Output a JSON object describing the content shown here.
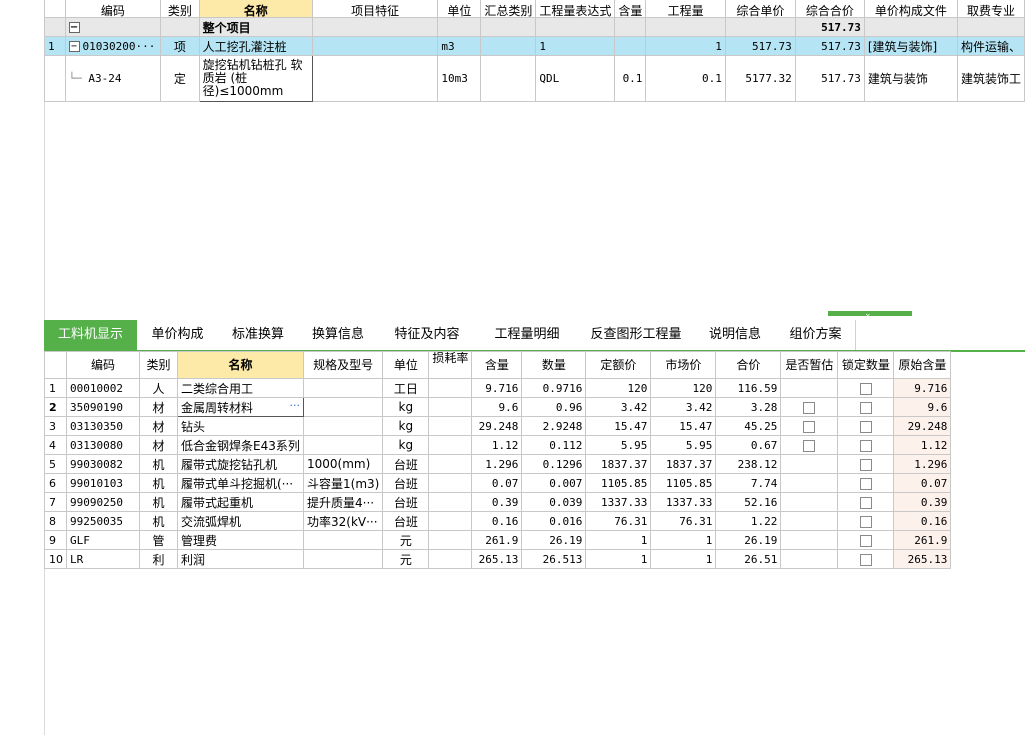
{
  "top_table": {
    "headers": [
      "编码",
      "类别",
      "名称",
      "项目特征",
      "单位",
      "汇总类别",
      "工程量表达式",
      "含量",
      "工程量",
      "综合单价",
      "综合合价",
      "单价构成文件",
      "取费专业"
    ],
    "summary": {
      "name": "整个项目",
      "total": "517.73"
    },
    "rows": [
      {
        "num": "1",
        "code": "01030200···",
        "type": "项",
        "name": "人工挖孔灌注桩",
        "feature": "",
        "unit": "m3",
        "sumcat": "",
        "expr": "1",
        "content": "",
        "qty": "1",
        "unit_price": "517.73",
        "total": "517.73",
        "price_file": "[建筑与装饰]",
        "fee": "构件运输、"
      },
      {
        "num": "",
        "code": "A3-24",
        "type": "定",
        "name": "旋挖钻机钻桩孔 软质岩 (桩径)≤1000mm",
        "feature": "",
        "unit": "10m3",
        "sumcat": "",
        "expr": "QDL",
        "content": "0.1",
        "qty": "0.1",
        "unit_price": "5177.32",
        "total": "517.73",
        "price_file": "建筑与装饰",
        "fee": "建筑装饰工"
      }
    ]
  },
  "tabs": [
    "工料机显示",
    "单价构成",
    "标准换算",
    "换算信息",
    "特征及内容",
    "工程量明细",
    "反查图形工程量",
    "说明信息",
    "组价方案"
  ],
  "bottom_table": {
    "headers": [
      "编码",
      "类别",
      "名称",
      "规格及型号",
      "单位",
      "损耗率",
      "含量",
      "数量",
      "定额价",
      "市场价",
      "合价",
      "是否暂估",
      "锁定数量",
      "原始含量"
    ],
    "rows": [
      {
        "num": "1",
        "code": "00010002",
        "type": "人",
        "name": "二类综合用工",
        "spec": "",
        "unit": "工日",
        "loss": "",
        "content": "9.716",
        "qty": "0.9716",
        "quota": "120",
        "market": "120",
        "total": "116.59",
        "est": false,
        "lock": true,
        "orig": "9.716"
      },
      {
        "num": "2",
        "code": "35090190",
        "type": "材",
        "name": "金属周转材料",
        "spec": "",
        "unit": "kg",
        "loss": "",
        "content": "9.6",
        "qty": "0.96",
        "quota": "3.42",
        "market": "3.42",
        "total": "3.28",
        "est": true,
        "lock": true,
        "orig": "9.6"
      },
      {
        "num": "3",
        "code": "03130350",
        "type": "材",
        "name": "钻头",
        "spec": "",
        "unit": "kg",
        "loss": "",
        "content": "29.248",
        "qty": "2.9248",
        "quota": "15.47",
        "market": "15.47",
        "total": "45.25",
        "est": true,
        "lock": true,
        "orig": "29.248"
      },
      {
        "num": "4",
        "code": "03130080",
        "type": "材",
        "name": "低合金钢焊条E43系列",
        "spec": "",
        "unit": "kg",
        "loss": "",
        "content": "1.12",
        "qty": "0.112",
        "quota": "5.95",
        "market": "5.95",
        "total": "0.67",
        "est": true,
        "lock": true,
        "orig": "1.12"
      },
      {
        "num": "5",
        "code": "99030082",
        "type": "机",
        "name": "履带式旋挖钻孔机",
        "spec": "1000(mm)",
        "unit": "台班",
        "loss": "",
        "content": "1.296",
        "qty": "0.1296",
        "quota": "1837.37",
        "market": "1837.37",
        "total": "238.12",
        "est": false,
        "lock": true,
        "orig": "1.296"
      },
      {
        "num": "6",
        "code": "99010103",
        "type": "机",
        "name": "履带式单斗挖掘机(···",
        "spec": "斗容量1(m3)",
        "unit": "台班",
        "loss": "",
        "content": "0.07",
        "qty": "0.007",
        "quota": "1105.85",
        "market": "1105.85",
        "total": "7.74",
        "est": false,
        "lock": true,
        "orig": "0.07"
      },
      {
        "num": "7",
        "code": "99090250",
        "type": "机",
        "name": "履带式起重机",
        "spec": "提升质量4···",
        "unit": "台班",
        "loss": "",
        "content": "0.39",
        "qty": "0.039",
        "quota": "1337.33",
        "market": "1337.33",
        "total": "52.16",
        "est": false,
        "lock": true,
        "orig": "0.39"
      },
      {
        "num": "8",
        "code": "99250035",
        "type": "机",
        "name": "交流弧焊机",
        "spec": "功率32(kV···",
        "unit": "台班",
        "loss": "",
        "content": "0.16",
        "qty": "0.016",
        "quota": "76.31",
        "market": "76.31",
        "total": "1.22",
        "est": false,
        "lock": true,
        "orig": "0.16"
      },
      {
        "num": "9",
        "code": "GLF",
        "type": "管",
        "name": "管理费",
        "spec": "",
        "unit": "元",
        "loss": "",
        "content": "261.9",
        "qty": "26.19",
        "quota": "1",
        "market": "1",
        "total": "26.19",
        "est": false,
        "lock": true,
        "orig": "261.9"
      },
      {
        "num": "10",
        "code": "LR",
        "type": "利",
        "name": "利润",
        "spec": "",
        "unit": "元",
        "loss": "",
        "content": "265.13",
        "qty": "26.513",
        "quota": "1",
        "market": "1",
        "total": "26.51",
        "est": false,
        "lock": true,
        "orig": "265.13"
      }
    ]
  },
  "colors": {
    "accent_green": "#55b04a",
    "selected_row": "#b5e5f4",
    "header_highlight": "#fde9a8"
  },
  "icons": {
    "collapse": "minus-box-icon",
    "more": "ellipsis-icon"
  },
  "selected_bottom_row": 1,
  "active_tab": 0
}
